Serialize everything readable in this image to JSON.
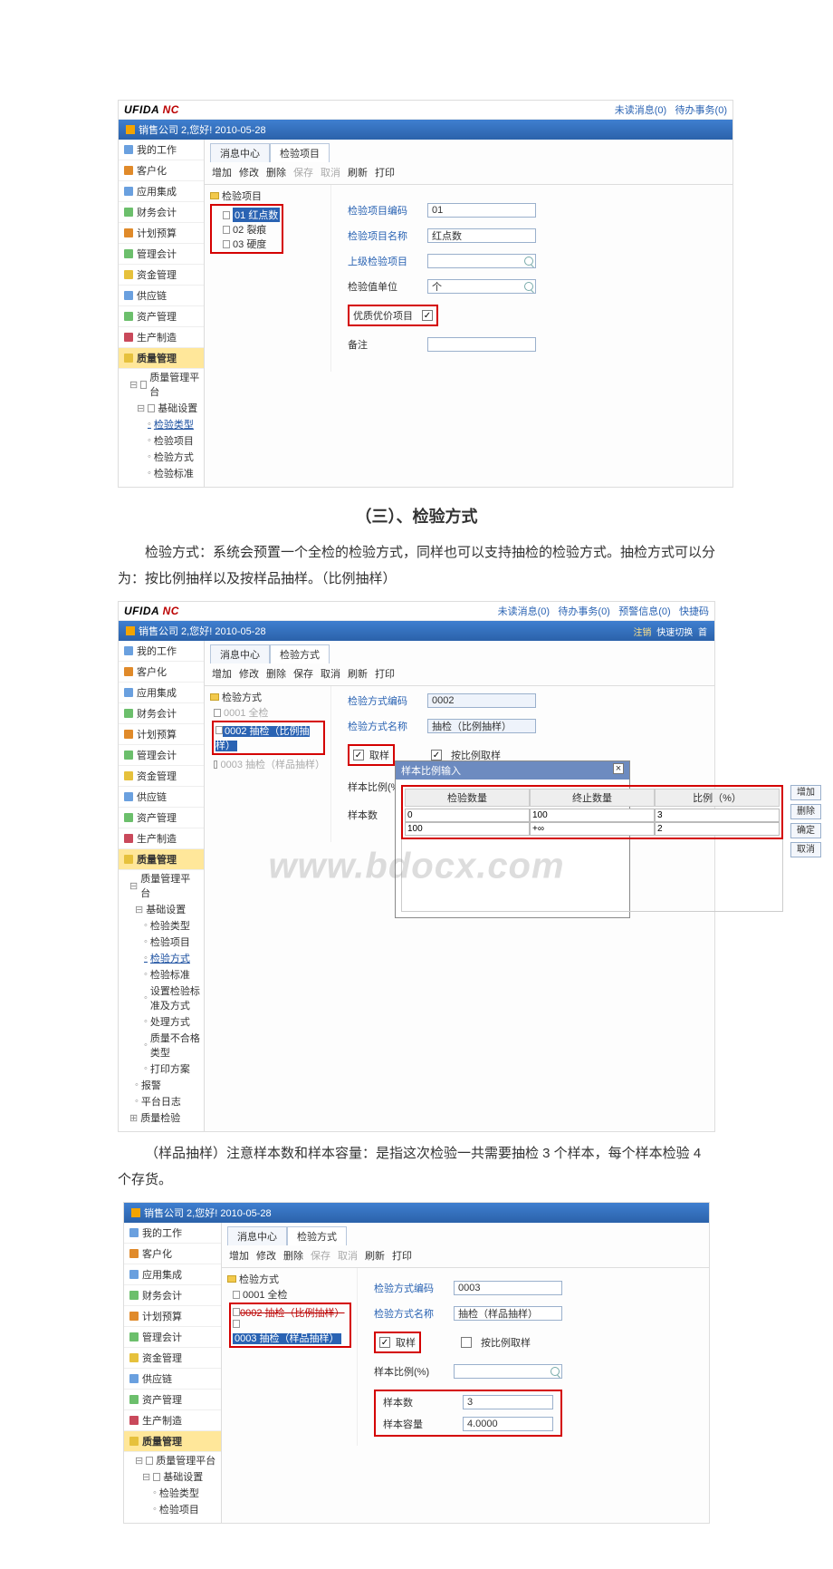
{
  "doc": {
    "section_title": "（三）、检验方式",
    "para1": "检验方式：系统会预置一个全检的检验方式，同样也可以支持抽检的检验方式。抽检方式可以分为：按比例抽样以及按样品抽样。（比例抽样）",
    "para2": "（样品抽样）注意样本数和样本容量：是指这次检验一共需要抽检 3 个样本，每个样本检验 4 个存货。",
    "watermark": "www.bdocx.com"
  },
  "top": {
    "brand_a": "UFIDA",
    "brand_b": "NC",
    "links": {
      "unread": "未读消息(0)",
      "todo": "待办事务(0)",
      "alarm": "预警信息(0)",
      "short": "快捷码"
    },
    "greeting": "销售公司 2,您好! 2010-05-28",
    "logout": "注销",
    "quick": "快速切换",
    "home": "首"
  },
  "nav": {
    "items": [
      {
        "label": "我的工作",
        "ico": "b"
      },
      {
        "label": "客户化",
        "ico": "o"
      },
      {
        "label": "应用集成",
        "ico": "b"
      },
      {
        "label": "财务会计",
        "ico": "g"
      },
      {
        "label": "计划预算",
        "ico": "o"
      },
      {
        "label": "管理会计",
        "ico": "g"
      },
      {
        "label": "资金管理",
        "ico": "y"
      },
      {
        "label": "供应链",
        "ico": "b"
      },
      {
        "label": "资产管理",
        "ico": "g"
      },
      {
        "label": "生产制造",
        "ico": "r"
      },
      {
        "label": "质量管理",
        "ico": "y",
        "active": true
      }
    ],
    "tree1": {
      "root": "质量管理平台",
      "base": "基础设置",
      "children": [
        "检验类型",
        "检验项目",
        "检验方式",
        "检验标准"
      ]
    },
    "tree2_extra": [
      "设置检验标准及方式",
      "处理方式",
      "质量不合格类型",
      "打印方案",
      "报警",
      "平台日志",
      "质量检验"
    ]
  },
  "shot1": {
    "tabs": [
      "消息中心",
      "检验项目"
    ],
    "toolbar": {
      "add": "增加",
      "edit": "修改",
      "del": "删除",
      "save": "保存",
      "cancel": "取消",
      "refresh": "刷新",
      "print": "打印"
    },
    "folder": "检验项目",
    "items": [
      {
        "code": "01",
        "name": "红点数",
        "hl": true
      },
      {
        "code": "02",
        "name": "裂痕"
      },
      {
        "code": "03",
        "name": "硬度"
      }
    ],
    "form": {
      "code_label": "检验项目编码",
      "code_val": "01",
      "name_label": "检验项目名称",
      "name_val": "红点数",
      "parent_label": "上级检验项目",
      "unit_label": "检验值单位",
      "unit_val": "个",
      "premium_label": "优质优价项目",
      "remark_label": "备注"
    }
  },
  "shot2": {
    "tabs": [
      "消息中心",
      "检验方式"
    ],
    "toolbar": {
      "add": "增加",
      "edit": "修改",
      "del": "删除",
      "save": "保存",
      "cancel": "取消",
      "refresh": "刷新",
      "print": "打印"
    },
    "folder": "检验方式",
    "items": [
      {
        "label": "0001 全检"
      },
      {
        "label": "0002 抽检（比例抽样）",
        "hl": true
      },
      {
        "label": "0003 抽检（样品抽样）"
      }
    ],
    "form": {
      "code_label": "检验方式编码",
      "code_val": "0002",
      "name_label": "检验方式名称",
      "name_val": "抽检（比例抽样）",
      "sample_label": "取样",
      "byratio_label": "按比例取样",
      "ratio_label": "样本比例(%)",
      "ratio_val": "10):3|(100,+∞):2|",
      "count_label": "样本数"
    },
    "popup": {
      "title": "样本比例输入",
      "cols": [
        "检验数量",
        "终止数量",
        "比例（%）"
      ],
      "rows": [
        [
          "0",
          "100",
          "3"
        ],
        [
          "100",
          "+∞",
          "2"
        ]
      ],
      "btns": {
        "add": "增加",
        "del": "删除",
        "ok": "确定",
        "cancel": "取消"
      }
    }
  },
  "shot3": {
    "tabs": [
      "消息中心",
      "检验方式"
    ],
    "toolbar": {
      "add": "增加",
      "edit": "修改",
      "del": "删除",
      "save": "保存",
      "cancel": "取消",
      "refresh": "刷新",
      "print": "打印"
    },
    "folder": "检验方式",
    "items": [
      {
        "label": "0001 全检"
      },
      {
        "label": "0002 抽检（比例抽样）",
        "strike": true
      },
      {
        "label": "0003 抽检（样品抽样）",
        "hl": true
      }
    ],
    "form": {
      "code_label": "检验方式编码",
      "code_val": "0003",
      "name_label": "检验方式名称",
      "name_val": "抽检（样品抽样）",
      "sample_label": "取样",
      "byratio_label": "按比例取样",
      "ratio_label": "样本比例(%)",
      "count_label": "样本数",
      "count_val": "3",
      "cap_label": "样本容量",
      "cap_val": "4.0000"
    }
  }
}
